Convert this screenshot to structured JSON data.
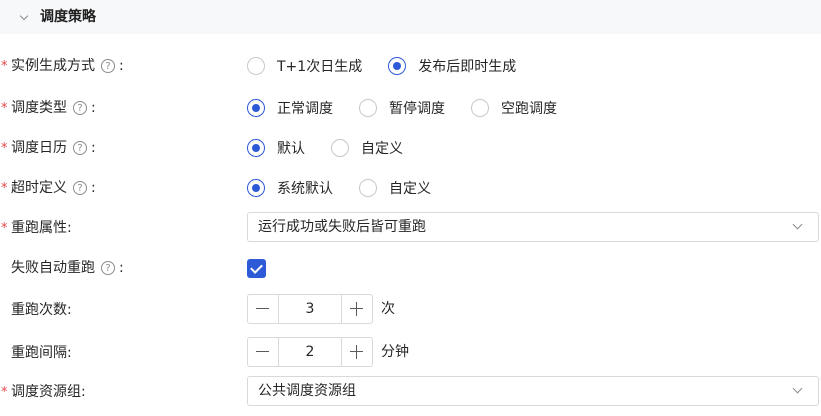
{
  "section": {
    "title": "调度策略"
  },
  "rows": {
    "instance_mode": {
      "label": "实例生成方式",
      "options": [
        "T+1次日生成",
        "发布后即时生成"
      ],
      "selected": 1
    },
    "schedule_type": {
      "label": "调度类型",
      "options": [
        "正常调度",
        "暂停调度",
        "空跑调度"
      ],
      "selected": 0
    },
    "calendar": {
      "label": "调度日历",
      "options": [
        "默认",
        "自定义"
      ],
      "selected": 0
    },
    "timeout": {
      "label": "超时定义",
      "options": [
        "系统默认",
        "自定义"
      ],
      "selected": 0
    },
    "rerun_attr": {
      "label": "重跑属性",
      "value": "运行成功或失败后皆可重跑"
    },
    "auto_rerun": {
      "label": "失败自动重跑",
      "checked": true
    },
    "rerun_count": {
      "label": "重跑次数",
      "value": "3",
      "unit": "次"
    },
    "rerun_interval": {
      "label": "重跑间隔",
      "value": "2",
      "unit": "分钟"
    },
    "resource_group": {
      "label": "调度资源组",
      "value": "公共调度资源组"
    }
  },
  "symbols": {
    "required": "*",
    "help": "?",
    "colon": ":"
  },
  "colors": {
    "accent": "#2d5bd8",
    "required": "#e5484d"
  }
}
